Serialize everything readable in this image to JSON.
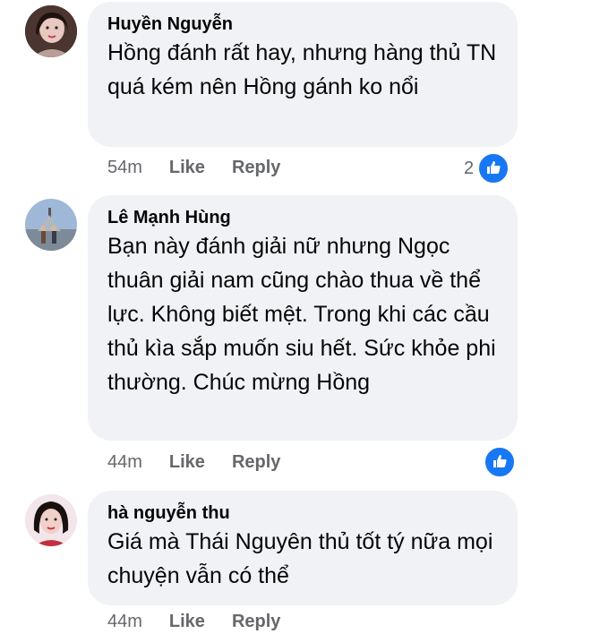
{
  "comments": [
    {
      "author": "Huyền Nguyễn",
      "text": "Hồng đánh rất hay, nhưng hàng thủ TN quá kém nên Hồng gánh ko nổi",
      "time": "54m",
      "like_label": "Like",
      "reply_label": "Reply",
      "reaction_count": "2",
      "reaction_icon": "like-icon",
      "accent": "#1877f2"
    },
    {
      "author": "Lê Mạnh Hùng",
      "text": "Bạn này đánh giải nữ nhưng Ngọc thuân giải nam cũng chào thua về thể lực. Không biết mệt. Trong khi các cầu thủ kìa sắp muốn siu hết. Sức khỏe phi thường. Chúc mừng Hồng",
      "time": "44m",
      "like_label": "Like",
      "reply_label": "Reply",
      "reaction_count": "",
      "reaction_icon": "like-icon"
    },
    {
      "author": "hà nguyễn thu",
      "text": "Giá mà Thái Nguyên thủ tốt tý nữa mọi chuyện vẫn có thể",
      "time": "44m",
      "like_label": "Like",
      "reply_label": "Reply"
    }
  ]
}
